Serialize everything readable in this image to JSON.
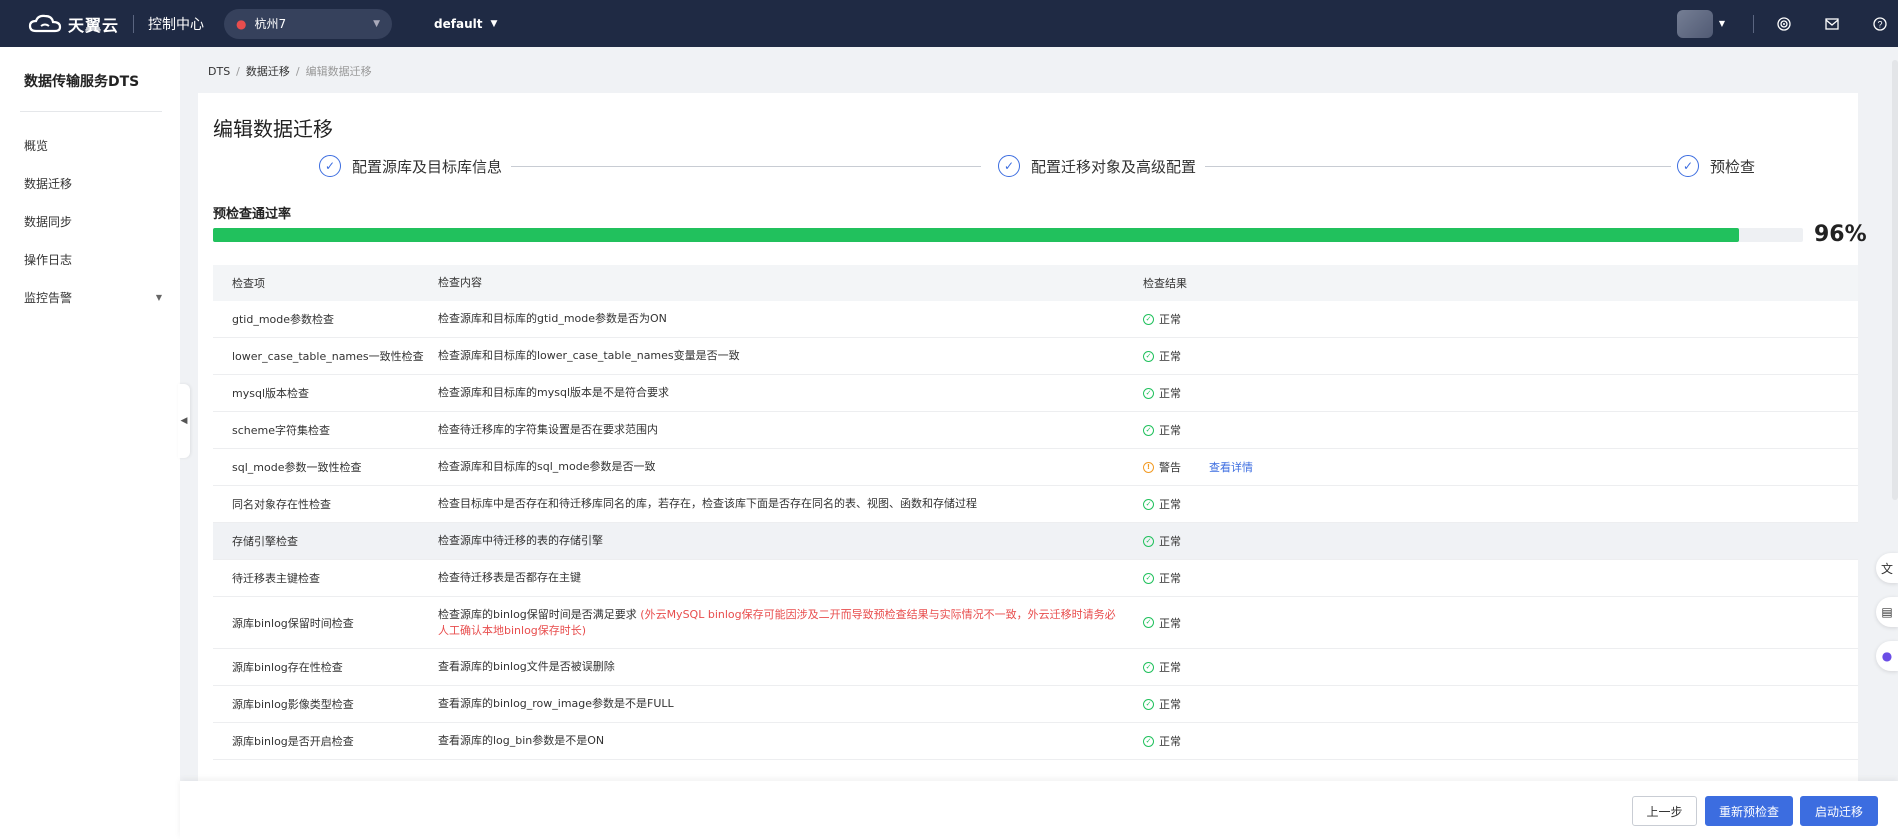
{
  "topbar": {
    "brand": "天翼云",
    "console": "控制中心",
    "region": "杭州7",
    "project": "default"
  },
  "sidebar": {
    "title": "数据传输服务DTS",
    "items": [
      {
        "label": "概览"
      },
      {
        "label": "数据迁移"
      },
      {
        "label": "数据同步"
      },
      {
        "label": "操作日志"
      },
      {
        "label": "监控告警"
      }
    ]
  },
  "breadcrumb": [
    "DTS",
    "数据迁移",
    "编辑数据迁移"
  ],
  "page": {
    "title": "编辑数据迁移",
    "steps": [
      "配置源库及目标库信息",
      "配置迁移对象及高级配置",
      "预检查"
    ],
    "pass_label": "预检查通过率",
    "pass_rate_text": "96%",
    "pass_rate": 0.96
  },
  "table": {
    "headers": [
      "检查项",
      "检查内容",
      "检查结果"
    ],
    "rows": [
      {
        "item": "gtid_mode参数检查",
        "content": "检查源库和目标库的gtid_mode参数是否为ON",
        "note": "",
        "result": "正常",
        "status": "ok"
      },
      {
        "item": "lower_case_table_names一致性检查",
        "content": "检查源库和目标库的lower_case_table_names变量是否一致",
        "note": "",
        "result": "正常",
        "status": "ok"
      },
      {
        "item": "mysql版本检查",
        "content": "检查源库和目标库的mysql版本是不是符合要求",
        "note": "",
        "result": "正常",
        "status": "ok"
      },
      {
        "item": "scheme字符集检查",
        "content": "检查待迁移库的字符集设置是否在要求范围内",
        "note": "",
        "result": "正常",
        "status": "ok"
      },
      {
        "item": "sql_mode参数一致性检查",
        "content": "检查源库和目标库的sql_mode参数是否一致",
        "note": "",
        "result": "警告",
        "status": "warn",
        "link": "查看详情"
      },
      {
        "item": "同名对象存在性检查",
        "content": "检查目标库中是否存在和待迁移库同名的库，若存在，检查该库下面是否存在同名的表、视图、函数和存储过程",
        "note": "",
        "result": "正常",
        "status": "ok"
      },
      {
        "item": "存储引擎检查",
        "content": "检查源库中待迁移的表的存储引擎",
        "note": "",
        "result": "正常",
        "status": "ok"
      },
      {
        "item": "待迁移表主键检查",
        "content": "检查待迁移表是否都存在主键",
        "note": "",
        "result": "正常",
        "status": "ok"
      },
      {
        "item": "源库binlog保留时间检查",
        "content": "检查源库的binlog保留时间是否满足要求",
        "note": " (外云MySQL binlog保存可能因涉及二开而导致预检查结果与实际情况不一致，外云迁移时请务必人工确认本地binlog保存时长)",
        "result": "正常",
        "status": "ok"
      },
      {
        "item": "源库binlog存在性检查",
        "content": "查看源库的binlog文件是否被误删除",
        "note": "",
        "result": "正常",
        "status": "ok"
      },
      {
        "item": "源库binlog影像类型检查",
        "content": "查看源库的binlog_row_image参数是不是FULL",
        "note": "",
        "result": "正常",
        "status": "ok"
      },
      {
        "item": "源库binlog是否开启检查",
        "content": "查看源库的log_bin参数是不是ON",
        "note": "",
        "result": "正常",
        "status": "ok"
      }
    ]
  },
  "footer": {
    "prev": "上一步",
    "recheck": "重新预检查",
    "start": "启动迁移"
  }
}
